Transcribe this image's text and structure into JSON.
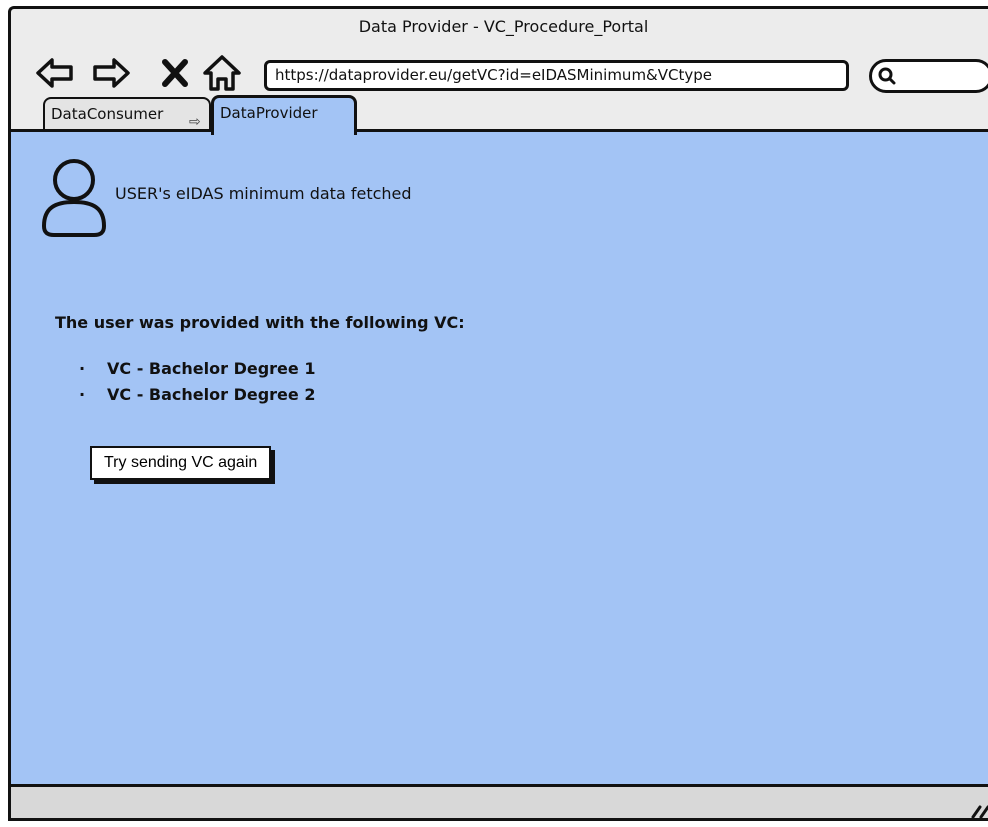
{
  "window": {
    "title": "Data Provider - VC_Procedure_Portal"
  },
  "toolbar": {
    "icons": {
      "back": "back-arrow-icon",
      "forward": "forward-arrow-icon",
      "close": "close-icon",
      "home": "home-icon",
      "search": "search-icon"
    },
    "url": "https://dataprovider.eu/getVC?id=eIDASMinimum&VCtype",
    "search_value": ""
  },
  "tabs": [
    {
      "label": "DataConsumer",
      "active": false
    },
    {
      "label": "DataProvider",
      "active": true
    }
  ],
  "main": {
    "user_status": "USER's eIDAS minimum data fetched",
    "vc_heading": "The user was provided with the following VC:",
    "bullet_symbol": "·",
    "vc_items": [
      "VC - Bachelor Degree 1",
      "VC - Bachelor Degree 2"
    ],
    "retry_button_label": "Try sending VC again"
  },
  "colors": {
    "content_background": "#a3c4f5",
    "window_chrome": "#ececec",
    "status_bar": "#d8d8d8",
    "outline": "#111111"
  }
}
